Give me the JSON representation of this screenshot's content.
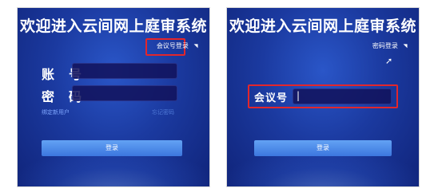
{
  "left": {
    "title": "欢迎进入云间网上庭审系统",
    "mode_link": "会议号登录",
    "account_label": "账号",
    "password_label": "密码",
    "bind_link": "绑定新用户",
    "forgot_link": "忘记密码",
    "login_button": "登录"
  },
  "right": {
    "title": "欢迎进入云间网上庭审系统",
    "mode_link": "密码登录",
    "meeting_label": "会议号",
    "meeting_value": "",
    "login_button": "登录"
  },
  "colors": {
    "panel_top": "#2a56c8",
    "panel_bottom": "#10247a",
    "highlight": "#e3262b",
    "button": "#4f8ee8"
  }
}
